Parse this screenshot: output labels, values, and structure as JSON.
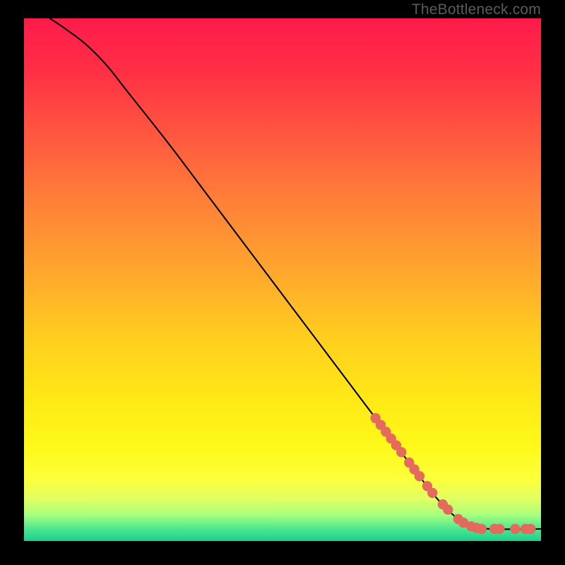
{
  "watermark": "TheBottleneck.com",
  "chart_data": {
    "type": "line",
    "title": "",
    "xlabel": "",
    "ylabel": "",
    "xlim": [
      0,
      100
    ],
    "ylim": [
      0,
      100
    ],
    "curve": [
      {
        "x": 5,
        "y": 100
      },
      {
        "x": 8,
        "y": 98
      },
      {
        "x": 12,
        "y": 95
      },
      {
        "x": 16,
        "y": 91
      },
      {
        "x": 20,
        "y": 86
      },
      {
        "x": 28,
        "y": 76
      },
      {
        "x": 36,
        "y": 65.5
      },
      {
        "x": 44,
        "y": 55
      },
      {
        "x": 52,
        "y": 44.5
      },
      {
        "x": 60,
        "y": 34
      },
      {
        "x": 68,
        "y": 23.5
      },
      {
        "x": 76,
        "y": 13
      },
      {
        "x": 80,
        "y": 8
      },
      {
        "x": 83,
        "y": 5
      },
      {
        "x": 86,
        "y": 3
      },
      {
        "x": 90,
        "y": 2.3
      },
      {
        "x": 100,
        "y": 2.3
      }
    ],
    "points": [
      {
        "x": 68,
        "y": 23.5
      },
      {
        "x": 69,
        "y": 22.2
      },
      {
        "x": 70,
        "y": 20.9
      },
      {
        "x": 71,
        "y": 19.6
      },
      {
        "x": 72,
        "y": 18.3
      },
      {
        "x": 73,
        "y": 17.0
      },
      {
        "x": 74.5,
        "y": 15.0
      },
      {
        "x": 75.5,
        "y": 13.7
      },
      {
        "x": 76.5,
        "y": 12.4
      },
      {
        "x": 78,
        "y": 10.5
      },
      {
        "x": 79,
        "y": 9.2
      },
      {
        "x": 81,
        "y": 7.0
      },
      {
        "x": 82,
        "y": 6.0
      },
      {
        "x": 84,
        "y": 4.2
      },
      {
        "x": 85,
        "y": 3.5
      },
      {
        "x": 86.5,
        "y": 2.8
      },
      {
        "x": 87.5,
        "y": 2.5
      },
      {
        "x": 88.5,
        "y": 2.3
      },
      {
        "x": 91,
        "y": 2.3
      },
      {
        "x": 92,
        "y": 2.3
      },
      {
        "x": 95,
        "y": 2.3
      },
      {
        "x": 97,
        "y": 2.3
      },
      {
        "x": 98,
        "y": 2.3
      }
    ],
    "gradient_stops": [
      {
        "offset": 0.0,
        "color": "#ff1b4b"
      },
      {
        "offset": 0.1,
        "color": "#ff2f45"
      },
      {
        "offset": 0.22,
        "color": "#ff5640"
      },
      {
        "offset": 0.35,
        "color": "#ff8038"
      },
      {
        "offset": 0.48,
        "color": "#ffa52e"
      },
      {
        "offset": 0.6,
        "color": "#ffcb20"
      },
      {
        "offset": 0.72,
        "color": "#ffe716"
      },
      {
        "offset": 0.82,
        "color": "#fff91a"
      },
      {
        "offset": 0.88,
        "color": "#fdff3a"
      },
      {
        "offset": 0.92,
        "color": "#e0ff62"
      },
      {
        "offset": 0.95,
        "color": "#a9ff7e"
      },
      {
        "offset": 0.975,
        "color": "#52e88f"
      },
      {
        "offset": 1.0,
        "color": "#1ad08e"
      }
    ],
    "point_color": "#e36a5c",
    "point_radius": 7.2,
    "line_color": "#000000",
    "line_width": 2.1
  }
}
